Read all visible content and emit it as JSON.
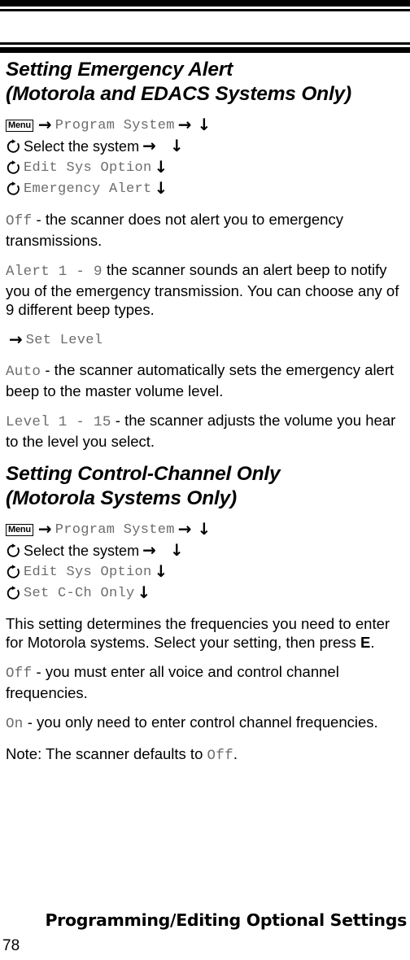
{
  "header": {
    "rule_color": "#000000"
  },
  "sections": [
    {
      "title_line1": "Setting Emergency Alert",
      "title_line2": "(Motorola and EDACS Systems Only)",
      "steps": [
        {
          "key_label": "Menu",
          "arrow1": "→",
          "step_text": "Program System",
          "step_style": "mono",
          "arrow2": "→",
          "arrow3": "↓"
        },
        {
          "icon": "rotary-knob-icon",
          "step_text": "Select the system",
          "step_style": "sans",
          "arrow2": "→",
          "arrow3": "↓"
        },
        {
          "icon": "rotary-knob-icon",
          "step_text": "Edit Sys Option",
          "step_style": "mono",
          "arrow3": "↓"
        },
        {
          "icon": "rotary-knob-icon",
          "step_text": "Emergency Alert",
          "step_style": "mono",
          "arrow3": "↓"
        }
      ],
      "paragraphs": [
        {
          "term": "Off",
          "text": " - the scanner does not alert you to emergency transmissions."
        },
        {
          "term": "Alert 1 - 9",
          "text": "  the scanner sounds an alert beep to notify you of the emergency transmission. You can choose any of 9 different beep types."
        }
      ],
      "sub_arrow_line": {
        "arrow": "→",
        "text": "Set Level"
      },
      "paragraphs2": [
        {
          "term": "Auto",
          "text": " - the scanner automatically sets the emergency alert beep to the master volume level."
        },
        {
          "term": "Level 1 - 15",
          "text": " - the scanner adjusts the volume you hear to the level you select."
        }
      ]
    },
    {
      "title_line1": "Setting Control-Channel Only",
      "title_line2": "(Motorola Systems Only)",
      "steps": [
        {
          "key_label": "Menu",
          "arrow1": "→",
          "step_text": "Program System",
          "step_style": "mono",
          "arrow2": "→",
          "arrow3": "↓"
        },
        {
          "icon": "rotary-knob-icon",
          "step_text": "Select the system",
          "step_style": "sans",
          "arrow2": "→",
          "arrow3": "↓"
        },
        {
          "icon": "rotary-knob-icon",
          "step_text": "Edit Sys Option",
          "step_style": "mono",
          "arrow3": "↓"
        },
        {
          "icon": "rotary-knob-icon",
          "step_text": "Set C-Ch Only",
          "step_style": "mono",
          "arrow3": "↓"
        }
      ],
      "intro_paragraph": {
        "part1": "This setting determines the frequencies you need to enter for Motorola systems. Select your setting, then press ",
        "bold": "E",
        "part2": "."
      },
      "paragraphs": [
        {
          "term": "Off",
          "text": "  - you must enter all voice and control channel frequencies."
        },
        {
          "term": "On",
          "text": " - you only need to enter control channel frequencies."
        }
      ],
      "note": {
        "prefix": "Note: The scanner defaults to ",
        "term": "Off",
        "suffix": "."
      }
    }
  ],
  "footer": {
    "title": "Programming/Editing Optional Settings",
    "page_number": "78"
  }
}
